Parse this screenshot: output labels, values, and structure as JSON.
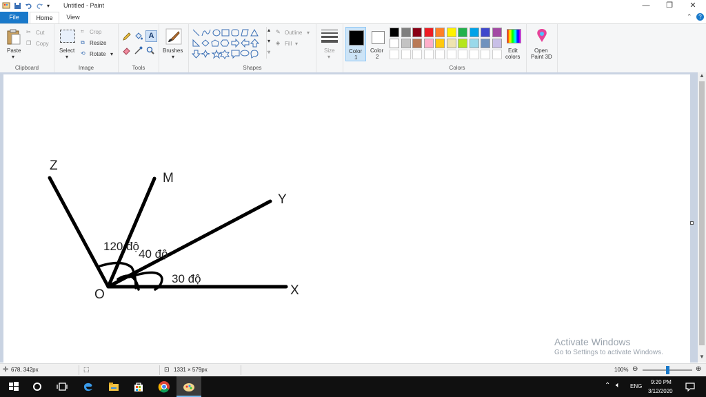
{
  "window": {
    "title": "Untitled - Paint",
    "controls": [
      "minimize-icon",
      "restore-icon",
      "close-icon"
    ]
  },
  "tabs": [
    {
      "label": "File"
    },
    {
      "label": "Home"
    },
    {
      "label": "View"
    }
  ],
  "ribbon": {
    "clipboard": {
      "group": "Clipboard",
      "paste": "Paste",
      "cut": "Cut",
      "copy": "Copy"
    },
    "image": {
      "group": "Image",
      "select": "Select",
      "crop": "Crop",
      "resize": "Resize",
      "rotate": "Rotate"
    },
    "tools": {
      "group": "Tools"
    },
    "brushes": {
      "label": "Brushes"
    },
    "shapes": {
      "group": "Shapes",
      "outline": "Outline",
      "fill": "Fill"
    },
    "size": {
      "label": "Size"
    },
    "color1": {
      "label1": "Color",
      "label2": "1"
    },
    "color2": {
      "label1": "Color",
      "label2": "2"
    },
    "colors": {
      "group": "Colors",
      "edit1": "Edit",
      "edit2": "colors",
      "open1": "Open",
      "open2": "Paint 3D"
    },
    "palette_row1": [
      "#000000",
      "#7f7f7f",
      "#880015",
      "#ed1c24",
      "#ff7f27",
      "#fff200",
      "#22b14c",
      "#00a2e8",
      "#3f48cc",
      "#a349a4"
    ],
    "palette_row2": [
      "#ffffff",
      "#c3c3c3",
      "#b97a57",
      "#ffaec9",
      "#ffc90e",
      "#efe4b0",
      "#b5e61d",
      "#99d9ea",
      "#7092be",
      "#c8bfe7"
    ]
  },
  "drawing": {
    "labels": {
      "z": "Z",
      "m": "M",
      "y": "Y",
      "x": "X",
      "o": "O",
      "angle_zox": "120 độ",
      "angle_mox": "40 độ",
      "angle_yox": "30 độ"
    }
  },
  "watermark": {
    "line1": "Activate Windows",
    "line2": "Go to Settings to activate Windows."
  },
  "status": {
    "cursor": "678, 342px",
    "canvas_size": "1331 × 579px",
    "zoom": "100%"
  },
  "taskbar": {
    "lang": "ENG",
    "time": "9:20 PM",
    "date": "3/12/2020"
  }
}
